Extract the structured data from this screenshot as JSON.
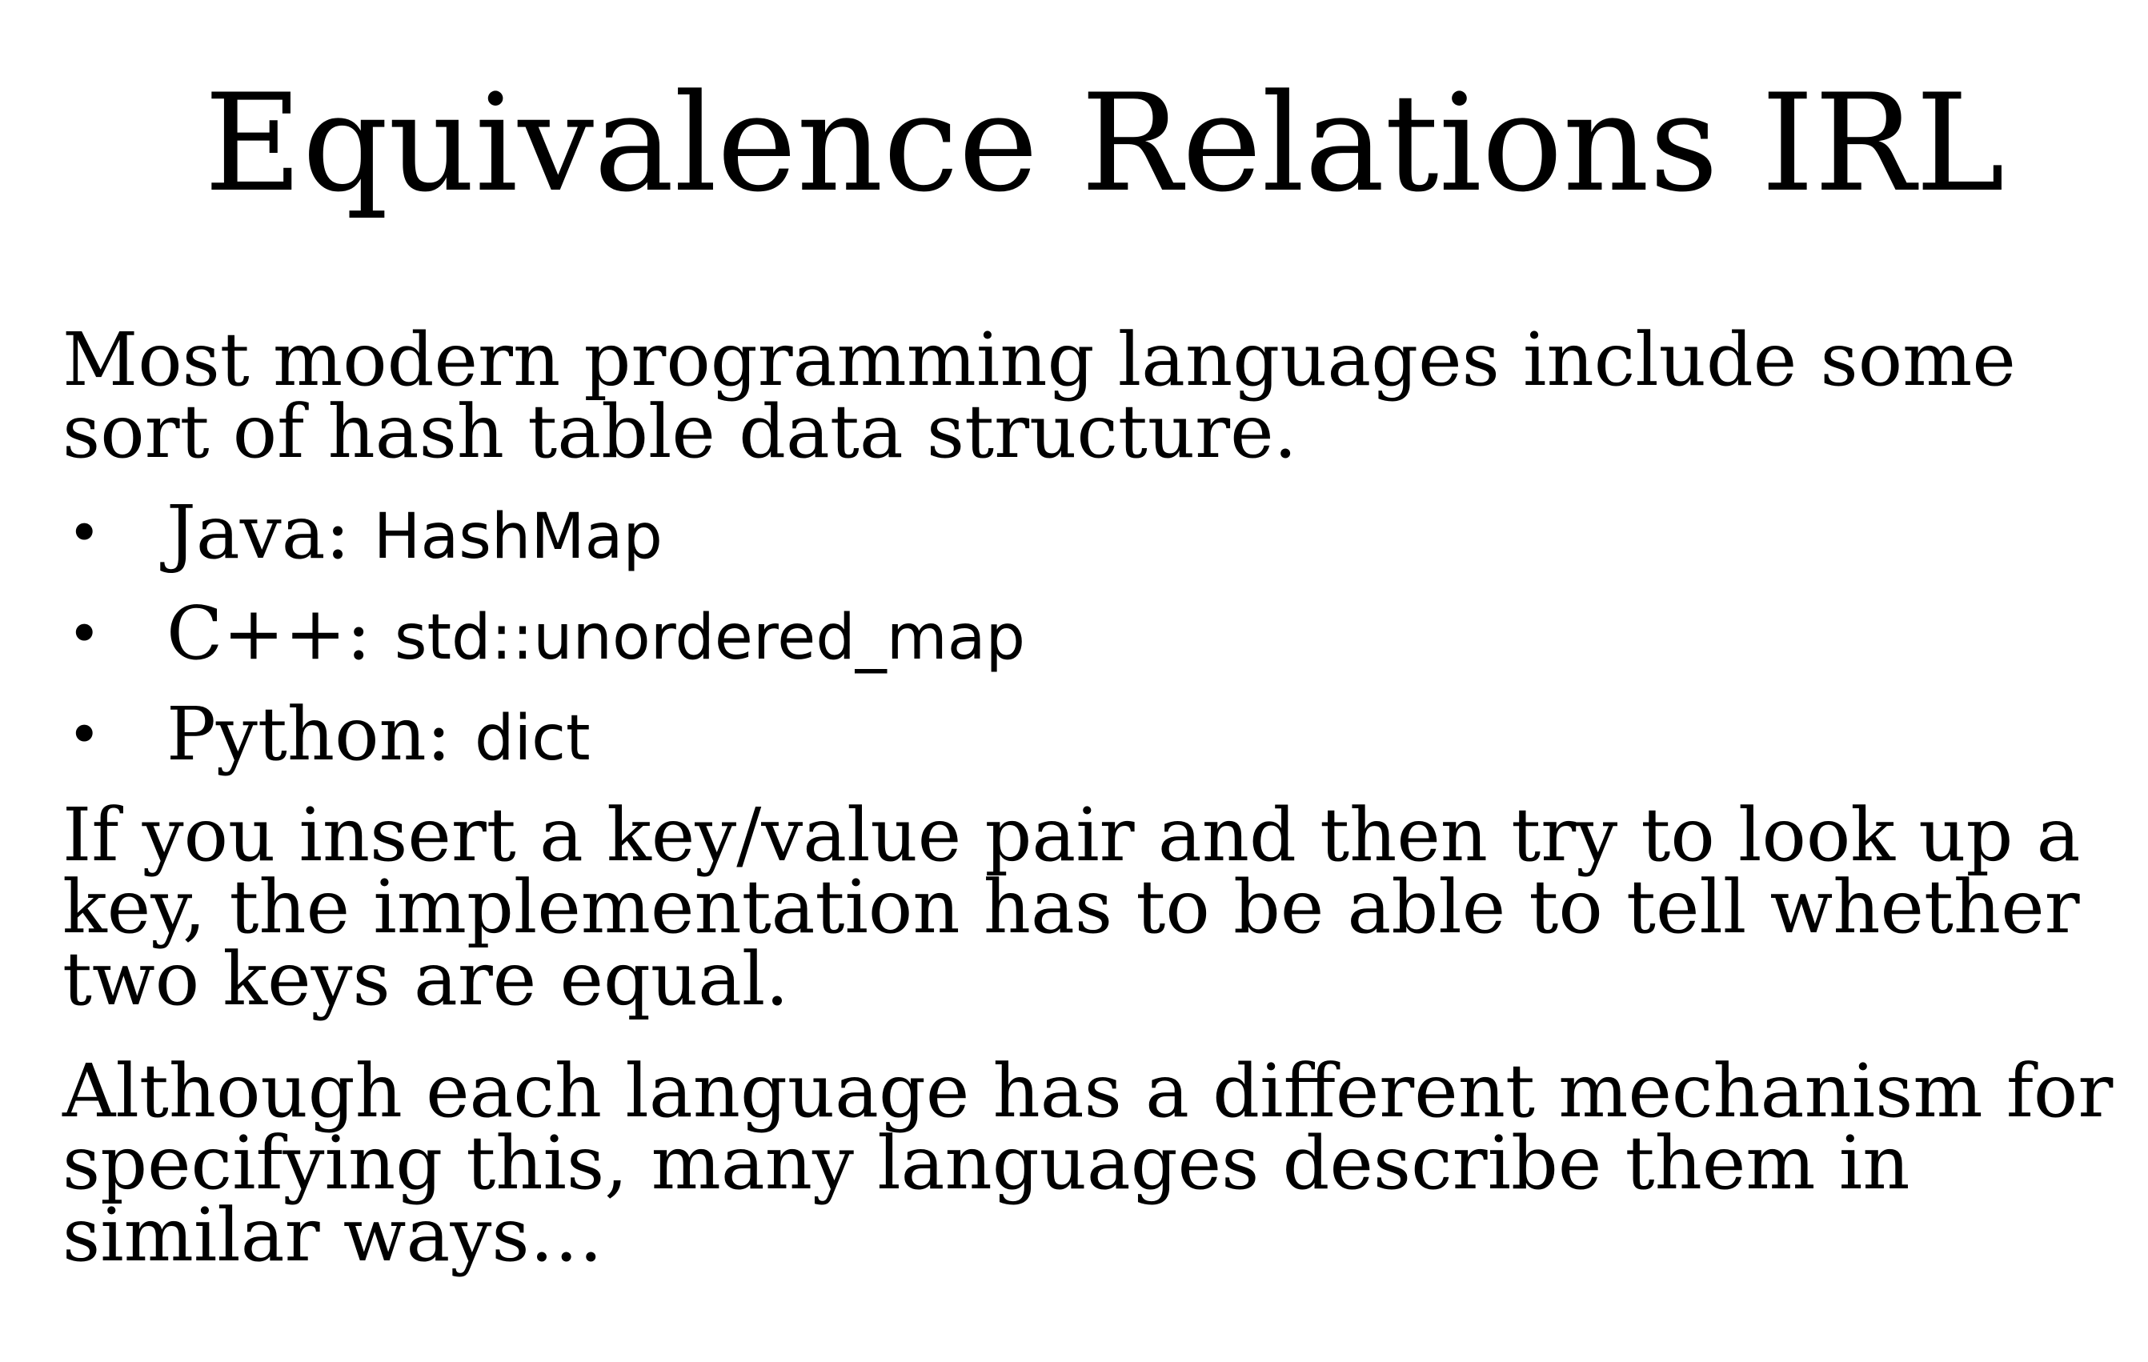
{
  "slide": {
    "title": "Equivalence Relations IRL",
    "intro": "Most modern programming languages include some sort of hash table data structure.",
    "bullets": [
      {
        "lang": "Java: ",
        "type": "HashMap"
      },
      {
        "lang": "C++: ",
        "type": "std::unordered_map"
      },
      {
        "lang": "Python: ",
        "type": "dict"
      }
    ],
    "paragraph2": "If you insert a key/value pair and then try to look up a key, the implementation has to be able to tell whether two keys are equal.",
    "paragraph3": "Although each language has a different mechanism for specifying this, many languages describe them in similar ways…",
    "bullet_glyph": "•"
  }
}
